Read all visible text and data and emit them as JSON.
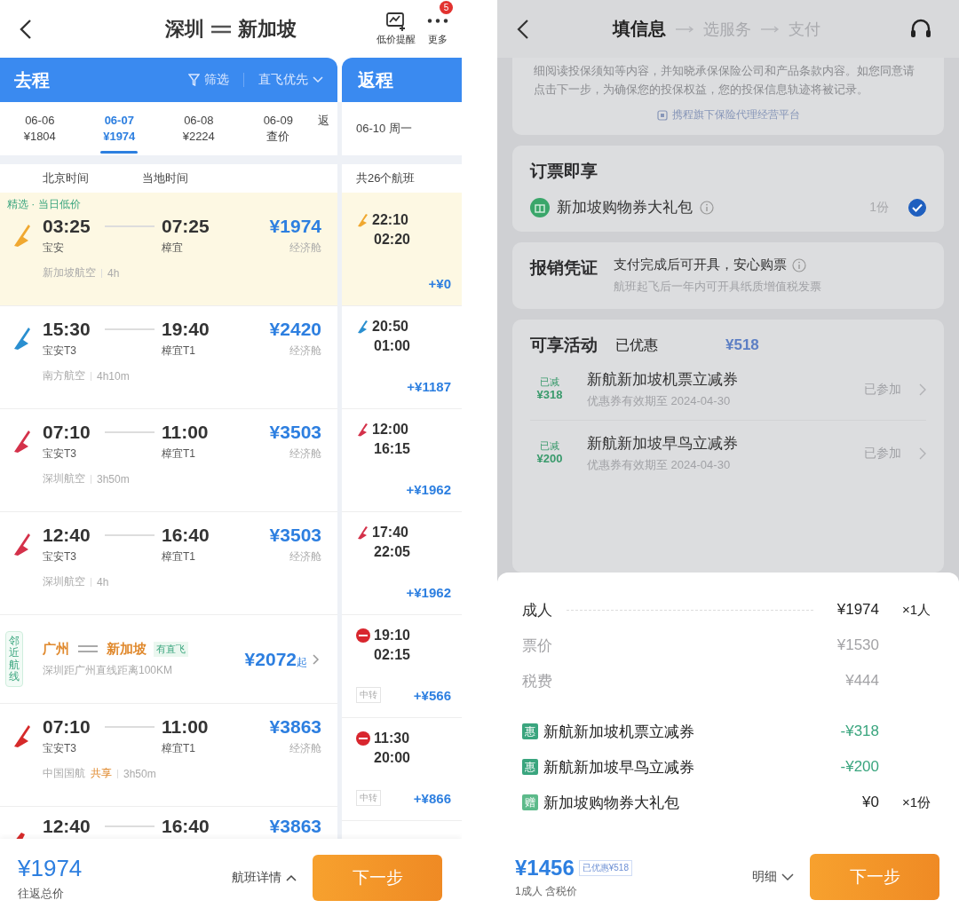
{
  "left": {
    "header": {
      "origin": "深圳",
      "destination": "新加坡",
      "actions": [
        {
          "kind": "alert",
          "label": "低价提醒"
        },
        {
          "kind": "more",
          "label": "更多",
          "badge": "5"
        }
      ]
    },
    "outbound_tab": {
      "label": "去程",
      "filter": "筛选",
      "sort": "直飞优先"
    },
    "return_tab": {
      "label": "返程"
    },
    "dates": [
      {
        "date": "06-06",
        "price": "¥1804",
        "selected": false
      },
      {
        "date": "06-07",
        "price": "¥1974",
        "selected": true
      },
      {
        "date": "06-08",
        "price": "¥2224",
        "selected": false
      },
      {
        "date": "06-09",
        "price": "查价",
        "selected": false
      }
    ],
    "dates_more": "返",
    "return_date": "06-10 周一",
    "columns": [
      "北京时间",
      "当地时间"
    ],
    "return_count": "共26个航班",
    "flights": [
      {
        "kind": "flight",
        "highlighted": true,
        "tag": "精选 · 当日低价",
        "color": "#f0a830",
        "depart": "03:25",
        "arrive": "07:25",
        "from": "宝安",
        "to": "樟宜",
        "price": "¥1974",
        "cabin": "经济舱",
        "airline": "新加坡航空",
        "duration": "4h"
      },
      {
        "kind": "flight",
        "highlighted": false,
        "color": "#2a8fd0",
        "depart": "15:30",
        "arrive": "19:40",
        "from": "宝安T3",
        "to": "樟宜T1",
        "price": "¥2420",
        "cabin": "经济舱",
        "airline": "南方航空",
        "duration": "4h10m"
      },
      {
        "kind": "flight",
        "highlighted": false,
        "color": "#d4314a",
        "depart": "07:10",
        "arrive": "11:00",
        "from": "宝安T3",
        "to": "樟宜T1",
        "price": "¥3503",
        "cabin": "经济舱",
        "airline": "深圳航空",
        "duration": "3h50m"
      },
      {
        "kind": "flight",
        "highlighted": false,
        "color": "#d4314a",
        "depart": "12:40",
        "arrive": "16:40",
        "from": "宝安T3",
        "to": "樟宜T1",
        "price": "¥3503",
        "cabin": "经济舱",
        "airline": "深圳航空",
        "duration": "4h"
      },
      {
        "kind": "nearby",
        "side_tag": "邻近航线",
        "from": "广州",
        "to": "新加坡",
        "badge": "有直飞",
        "note": "深圳距广州直线距离100KM",
        "price": "¥2072",
        "suffix": "起"
      },
      {
        "kind": "flight",
        "highlighted": false,
        "color": "#d62a2a",
        "depart": "07:10",
        "arrive": "11:00",
        "from": "宝安T3",
        "to": "樟宜T1",
        "price": "¥3863",
        "cabin": "经济舱",
        "airline": "中国国航",
        "shared": "共享",
        "duration": "3h50m"
      },
      {
        "kind": "partial",
        "color": "#d62a2a",
        "depart": "12:40",
        "arrive": "16:40",
        "price": "¥3863"
      }
    ],
    "returns": [
      {
        "highlighted": true,
        "kind": "fin",
        "color": "#f0a830",
        "depart": "22:10",
        "arrive": "02:20",
        "price": "+¥0"
      },
      {
        "highlighted": false,
        "kind": "fin",
        "color": "#2a8fd0",
        "depart": "20:50",
        "arrive": "01:00",
        "price": "+¥1187"
      },
      {
        "highlighted": false,
        "kind": "fin",
        "color": "#d4314a",
        "depart": "12:00",
        "arrive": "16:15",
        "price": "+¥1962"
      },
      {
        "highlighted": false,
        "kind": "fin",
        "color": "#d4314a",
        "depart": "17:40",
        "arrive": "22:05",
        "price": "+¥1962"
      },
      {
        "highlighted": false,
        "kind": "disc",
        "color": "#d8262e",
        "depart": "19:10",
        "arrive": "02:15",
        "transfer": "中转",
        "price": "+¥566"
      },
      {
        "highlighted": false,
        "kind": "disc",
        "color": "#d8262e",
        "depart": "11:30",
        "arrive": "20:00",
        "transfer": "中转",
        "price": "+¥866"
      }
    ],
    "footer": {
      "price": "¥1974",
      "label": "往返总价",
      "details": "航班详情",
      "next": "下一步"
    }
  },
  "right": {
    "steps": [
      {
        "label": "填信息",
        "selected": true
      },
      {
        "label": "选服务",
        "selected": false
      },
      {
        "label": "支付",
        "selected": false
      }
    ],
    "insurance": {
      "text": "细阅读投保须知等内容，并知晓承保保险公司和产品条款内容。如您同意请点击下一步，为确保您的投保权益，您的投保信息轨迹将被记录。",
      "link": "携程旗下保险代理经营平台"
    },
    "perks": {
      "title": "订票即享",
      "items": [
        {
          "name": "新加坡购物券大礼包",
          "qty": "1份",
          "checked": true
        }
      ]
    },
    "invoice": {
      "title": "报销凭证",
      "text": "支付完成后可开具，安心购票",
      "note": "航班起飞后一年内可开具纸质增值税发票"
    },
    "promos": {
      "title": "可享活动",
      "status": "已优惠",
      "amount": "¥518",
      "items": [
        {
          "badge": "已减",
          "value": "¥318",
          "name": "新航新加坡机票立减券",
          "validity": "优惠券有效期至 2024-04-30",
          "state": "已参加"
        },
        {
          "badge": "已减",
          "value": "¥200",
          "name": "新航新加坡早鸟立减券",
          "validity": "优惠券有效期至 2024-04-30",
          "state": "已参加"
        }
      ]
    },
    "sheet": {
      "lines": [
        {
          "kind": "main",
          "label": "成人",
          "amount": "¥1974",
          "qty": "×1人"
        },
        {
          "kind": "sub",
          "label": "票价",
          "amount": "¥1530"
        },
        {
          "kind": "sub",
          "label": "税费",
          "amount": "¥444"
        },
        {
          "kind": "discount",
          "icon": "惠",
          "label": "新航新加坡机票立减券",
          "amount": "-¥318"
        },
        {
          "kind": "discount",
          "icon": "惠",
          "label": "新航新加坡早鸟立减券",
          "amount": "-¥200"
        },
        {
          "kind": "gift",
          "icon": "赠",
          "label": "新加坡购物券大礼包",
          "amount": "¥0",
          "qty": "×1份"
        }
      ],
      "footer": {
        "price": "¥1456",
        "saved": "已优惠¥518",
        "label": "1成人 含税价",
        "details": "明细",
        "next": "下一步"
      }
    }
  }
}
